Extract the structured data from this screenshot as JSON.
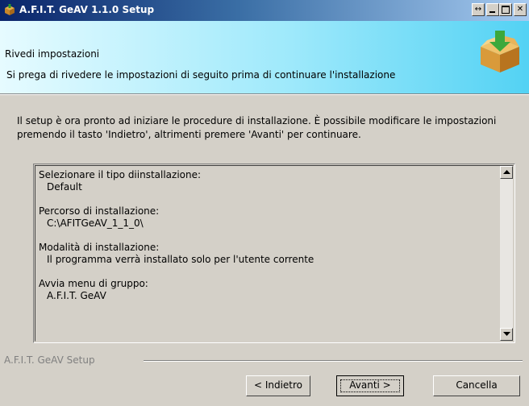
{
  "window": {
    "title": "A.F.I.T. GeAV 1.1.0 Setup",
    "icons": [
      "package-icon",
      "resize-icon",
      "minimize-icon",
      "maximize-icon",
      "close-icon"
    ]
  },
  "header": {
    "title": "Rivedi impostazioni",
    "subtitle": "Si prega di rivedere le impostazioni di seguito prima di continuare l'installazione"
  },
  "intro": "Il setup è ora pronto ad iniziare le procedure di installazione. È possibile modificare le impostazioni premendo il tasto 'Indietro', altrimenti premere 'Avanti' per continuare.",
  "summary": {
    "sections": [
      {
        "label": "Selezionare il tipo diinstallazione:",
        "value": "Default"
      },
      {
        "label": "Percorso di installazione:",
        "value": "C:\\AFITGeAV_1_1_0\\"
      },
      {
        "label": "Modalità di installazione:",
        "value": "Il programma verrà installato solo per l'utente corrente"
      },
      {
        "label": "Avvia menu di gruppo:",
        "value": "A.F.I.T. GeAV"
      }
    ]
  },
  "footer": {
    "brand": "A.F.I.T. GeAV Setup",
    "back_label": "< Indietro",
    "next_label": "Avanti >",
    "cancel_label": "Cancella"
  },
  "colors": {
    "title_bar_start": "#0a246a",
    "title_bar_end": "#a6caf0",
    "header_gradient_end": "#53d2f4",
    "face": "#d4d0c8"
  }
}
